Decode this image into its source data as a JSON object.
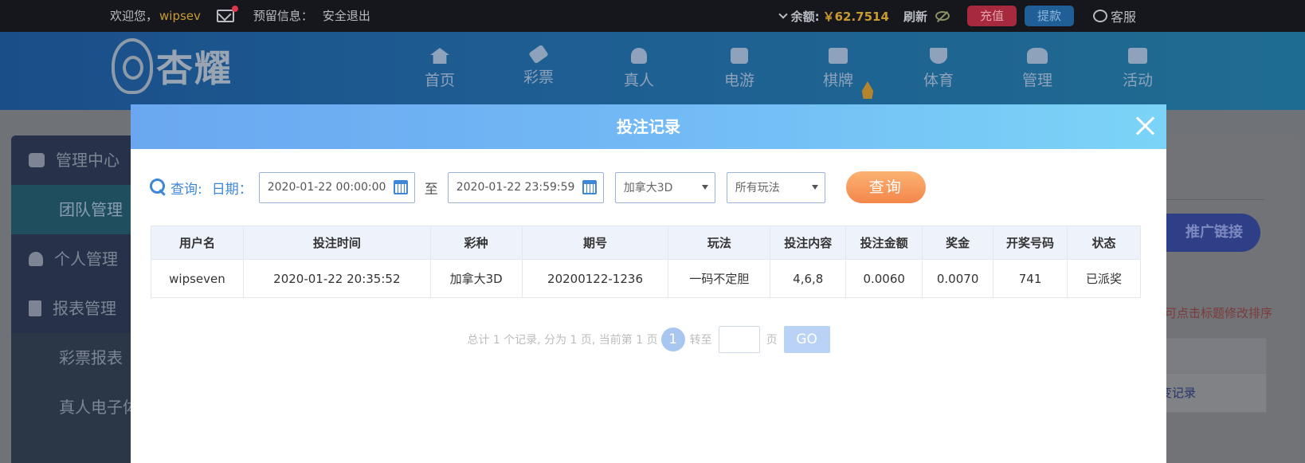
{
  "topbar": {
    "welcome": "欢迎您，",
    "username": "wipsev",
    "reserved_info": "预留信息：",
    "logout": "安全退出",
    "balance_label": "余额:",
    "balance_value": "￥62.7514",
    "refresh": "刷新",
    "recharge": "充值",
    "withdraw": "提款",
    "customer_service": "客服"
  },
  "logo": {
    "text": "杏耀"
  },
  "nav": [
    {
      "label": "首页",
      "icon": "home-icon"
    },
    {
      "label": "彩票",
      "icon": "ticket-icon"
    },
    {
      "label": "真人",
      "icon": "person-icon"
    },
    {
      "label": "电游",
      "icon": "game-icon"
    },
    {
      "label": "棋牌",
      "icon": "cards-icon"
    },
    {
      "label": "体育",
      "icon": "trophy-icon"
    },
    {
      "label": "管理",
      "icon": "users-icon"
    },
    {
      "label": "活动",
      "icon": "gift-icon"
    }
  ],
  "sidebar": {
    "items": [
      {
        "label": "管理中心",
        "icon": "users-icon"
      },
      {
        "label": "团队管理"
      },
      {
        "label": "个人管理",
        "icon": "person-icon"
      },
      {
        "label": "报表管理",
        "icon": "document-icon"
      },
      {
        "label": "彩票报表"
      },
      {
        "label": "真人电子体"
      }
    ]
  },
  "right_panel": {
    "promo_button": "推广链接",
    "sort_hint": "可点击标题修改排序",
    "link": "变记录"
  },
  "modal": {
    "title": "投注记录",
    "query": {
      "label": "查询:",
      "date_label": "日期：",
      "start_date": "2020-01-22 00:00:00",
      "to_label": "至",
      "end_date": "2020-01-22 23:59:59",
      "lottery_select": "加拿大3D",
      "play_select": "所有玩法",
      "button": "查询"
    },
    "table": {
      "headers": [
        "用户名",
        "投注时间",
        "彩种",
        "期号",
        "玩法",
        "投注内容",
        "投注金额",
        "奖金",
        "开奖号码",
        "状态"
      ],
      "rows": [
        [
          "wipseven",
          "2020-01-22 20:35:52",
          "加拿大3D",
          "20200122-1236",
          "一码不定胆",
          "4,6,8",
          "0.0060",
          "0.0070",
          "741",
          "已派奖"
        ]
      ]
    },
    "pager": {
      "summary": "总计 1 个记录, 分为 1 页, 当前第 1 页",
      "current_page": "1",
      "goto_label": "转至",
      "page_suffix": "页",
      "go_button": "GO"
    }
  },
  "colors": {
    "accent_blue": "#3d86d8",
    "status_paid": "#e2882d",
    "query_button": "#f4864a"
  }
}
